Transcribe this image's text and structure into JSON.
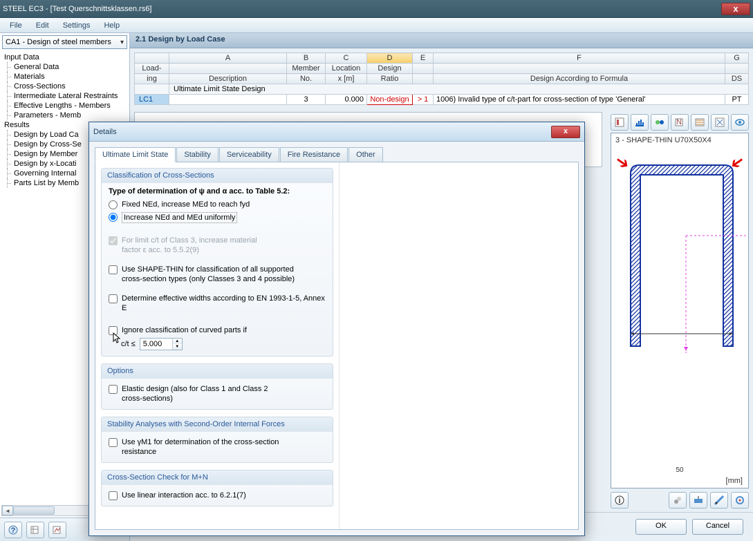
{
  "window": {
    "title": "STEEL EC3 - [Test Querschnittsklassen.rs6]",
    "close": "x"
  },
  "menubar": [
    "File",
    "Edit",
    "Settings",
    "Help"
  ],
  "dropdown": "CA1 - Design of steel members",
  "tree": {
    "roots": [
      {
        "label": "Input Data",
        "children": [
          "General Data",
          "Materials",
          "Cross-Sections",
          "Intermediate Lateral Restraints",
          "Effective Lengths - Members",
          "Parameters - Memb"
        ]
      },
      {
        "label": "Results",
        "children": [
          "Design by Load Ca",
          "Design by Cross-Se",
          "Design by Member",
          "Design by x-Locati",
          "Governing Internal",
          "Parts List by Memb"
        ]
      }
    ]
  },
  "main": {
    "header": "2.1 Design by Load Case",
    "colLetters": [
      "",
      "A",
      "B",
      "C",
      "D",
      "E",
      "F",
      "G"
    ],
    "colHeads1": [
      "Load-",
      "",
      "Member",
      "Location",
      "Design",
      "",
      "",
      ""
    ],
    "colHeads2": [
      "ing",
      "Description",
      "No.",
      "x [m]",
      "Ratio",
      "",
      "Design According to Formula",
      "DS"
    ],
    "groupRow": "Ultimate Limit State Design",
    "row": {
      "lc": "LC1",
      "desc": "",
      "member": "3",
      "x": "0.000",
      "ratio": "Non-design",
      "gt": "> 1",
      "formula": "1006) Invalid type of c/t-part for cross-section of type 'General'",
      "ds": "PT"
    }
  },
  "dialog": {
    "title": "Details",
    "close": "x",
    "tabs": [
      "Ultimate Limit State",
      "Stability",
      "Serviceability",
      "Fire Resistance",
      "Other"
    ],
    "grp1": {
      "title": "Classification of Cross-Sections",
      "type": "Type of determination of ψ and α acc. to Table 5.2:",
      "opt1": "Fixed NEd, increase MEd to reach fyd",
      "opt2": "Increase NEd and MEd uniformly",
      "chk1": "For limit c/t of Class 3, increase material\nfactor ε acc. to 5.5.2(9)",
      "chk2": "Use SHAPE-THIN for classification of all supported\ncross-section types (only Classes 3 and 4 possible)",
      "chk3": "Determine effective widths according to EN 1993-1-5, Annex E",
      "chk4": "Ignore classification of curved parts if",
      "ratioLabel": "c/t ≤",
      "ratioVal": "5.000"
    },
    "grp2": {
      "title": "Options",
      "chk": "Elastic design (also for Class 1 and Class 2\ncross-sections)"
    },
    "grp3": {
      "title": "Stability Analyses with Second-Order Internal Forces",
      "chk": "Use γM1 for determination of the cross-section\nresistance"
    },
    "grp4": {
      "title": "Cross-Section Check for M+N",
      "chk": "Use linear interaction acc. to 6.2.1(7)"
    }
  },
  "section": {
    "title": "3 - SHAPE-THIN U70X50X4",
    "dim": "50",
    "unit": "[mm]"
  },
  "buttons": {
    "ok": "OK",
    "cancel": "Cancel"
  }
}
